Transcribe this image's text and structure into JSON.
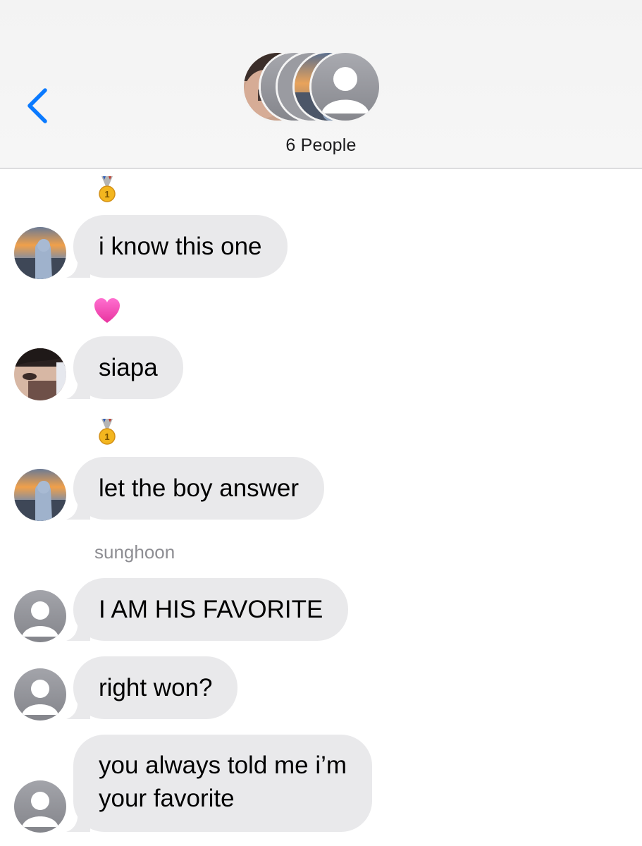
{
  "header": {
    "back_icon": "chevron-left-icon",
    "group_count": "6 People",
    "accent_color": "#007aff"
  },
  "messages": [
    {
      "sender": "participant-sunset",
      "tapback": "gold-medal",
      "text": "i know this one"
    },
    {
      "sender": "participant-closeup",
      "tapback": "pink-heart",
      "text": "siapa"
    },
    {
      "sender": "participant-sunset",
      "tapback": "gold-medal",
      "text": "let the boy answer"
    },
    {
      "sender": "sunghoon",
      "sender_label": "sunghoon",
      "text": "I AM HIS FAVORITE"
    },
    {
      "sender": "sunghoon",
      "text": "right won?"
    },
    {
      "sender": "sunghoon",
      "text_lines": [
        "you always told me i’m",
        "your favorite"
      ]
    }
  ],
  "colors": {
    "bubble": "#e9e9eb",
    "header_bg": "#f4f4f4",
    "sender_label": "#8e8e93",
    "placeholder_avatar": "#8e8e93"
  }
}
